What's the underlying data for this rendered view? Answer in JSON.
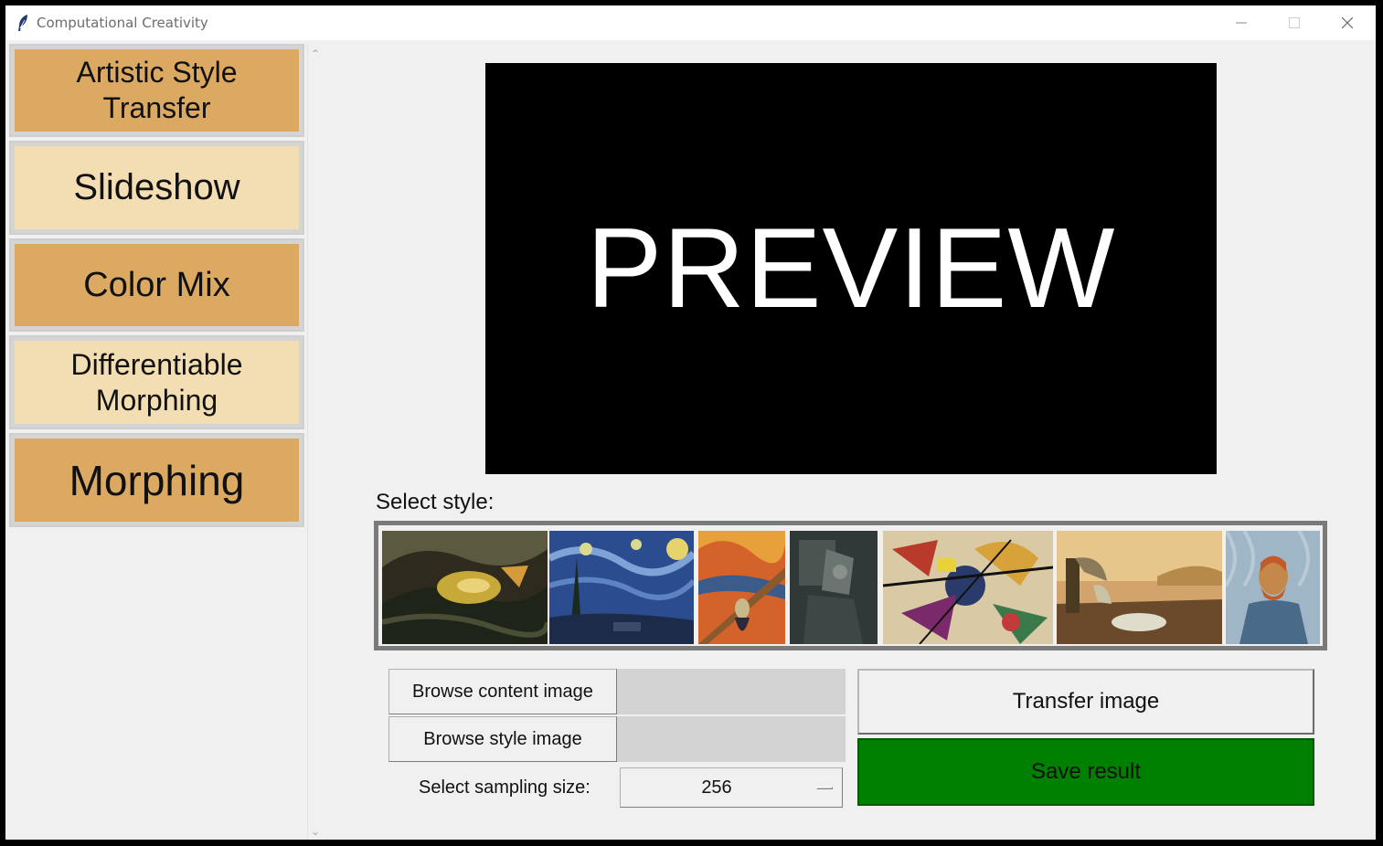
{
  "window": {
    "title": "Computational Creativity"
  },
  "sidebar": {
    "items": [
      {
        "label_lines": [
          "Artistic Style",
          "Transfer"
        ]
      },
      {
        "label_lines": [
          "Slideshow"
        ]
      },
      {
        "label_lines": [
          "Color Mix"
        ]
      },
      {
        "label_lines": [
          "Differentiable",
          "Morphing"
        ]
      },
      {
        "label_lines": [
          "Morphing"
        ]
      }
    ]
  },
  "preview": {
    "text": "PREVIEW"
  },
  "styles": {
    "label": "Select style:",
    "thumbnails": [
      {
        "icon": "turner-shipwreck-painting"
      },
      {
        "icon": "van-gogh-starry-night-painting"
      },
      {
        "icon": "munch-scream-painting"
      },
      {
        "icon": "picasso-portrait-painting"
      },
      {
        "icon": "kandinsky-composition-painting"
      },
      {
        "icon": "dali-persistence-of-memory-painting"
      },
      {
        "icon": "van-gogh-self-portrait-painting"
      }
    ]
  },
  "controls": {
    "browse_content_label": "Browse content image",
    "browse_style_label": "Browse style image",
    "content_path": "",
    "style_path": "",
    "sampling_label": "Select sampling size:",
    "sampling_value": "256",
    "transfer_label": "Transfer image",
    "save_label": "Save result"
  },
  "colors": {
    "nav_dark": "#dba962",
    "nav_light": "#f3deb4",
    "save_green": "#008000",
    "preview_bg": "#000000"
  }
}
